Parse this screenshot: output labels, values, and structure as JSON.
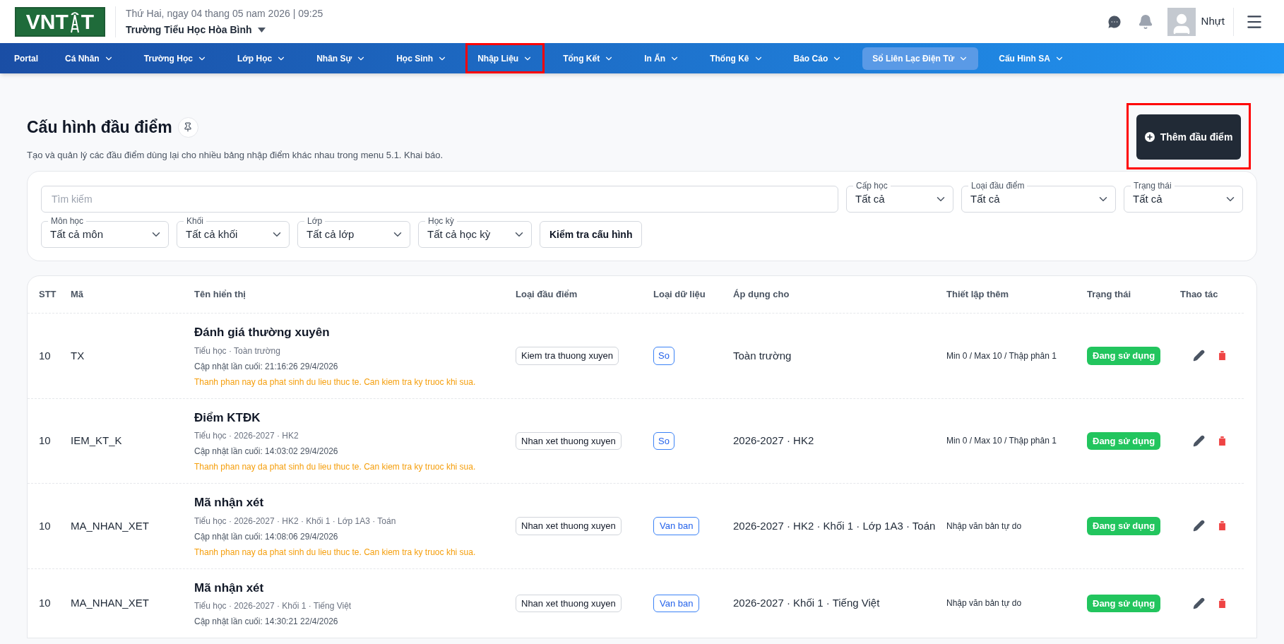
{
  "logo": {
    "text_before": "VNT",
    "text_after": "T"
  },
  "header": {
    "date": "Thứ Hai, ngay 04 thang 05 nam 2026 | 09:25",
    "school": "Trường Tiểu Học Hòa Bình",
    "user": "Nhựt"
  },
  "nav": [
    {
      "label": "Portal",
      "dropdown": false,
      "selected": false,
      "highlighted": false
    },
    {
      "label": "Cá Nhân",
      "dropdown": true,
      "selected": false,
      "highlighted": false
    },
    {
      "label": "Trường Học",
      "dropdown": true,
      "selected": false,
      "highlighted": false
    },
    {
      "label": "Lớp Học",
      "dropdown": true,
      "selected": false,
      "highlighted": false
    },
    {
      "label": "Nhân Sự",
      "dropdown": true,
      "selected": false,
      "highlighted": false
    },
    {
      "label": "Học Sinh",
      "dropdown": true,
      "selected": false,
      "highlighted": false
    },
    {
      "label": "Nhập Liệu",
      "dropdown": true,
      "selected": false,
      "highlighted": true
    },
    {
      "label": "Tổng Kết",
      "dropdown": true,
      "selected": false,
      "highlighted": false
    },
    {
      "label": "In Ấn",
      "dropdown": true,
      "selected": false,
      "highlighted": false
    },
    {
      "label": "Thống Kê",
      "dropdown": true,
      "selected": false,
      "highlighted": false
    },
    {
      "label": "Báo Cáo",
      "dropdown": true,
      "selected": false,
      "highlighted": false
    },
    {
      "label": "Sổ Liên Lạc Điện Tử",
      "dropdown": true,
      "selected": true,
      "highlighted": false
    },
    {
      "label": "Cấu Hình SA",
      "dropdown": true,
      "selected": false,
      "highlighted": false
    }
  ],
  "page": {
    "title": "Cấu hình đầu điểm",
    "description": "Tạo và quản lý các đầu điểm dùng lại cho nhiều bảng nhập điểm khác nhau trong menu 5.1. Khai báo.",
    "add_button": {
      "label": "Thêm đầu điểm",
      "highlighted": true
    }
  },
  "filters": {
    "search": {
      "placeholder": "Tìm kiếm"
    },
    "row_1_selects": [
      {
        "label": "Cấp học",
        "value": "Tất cả"
      },
      {
        "label": "Loại đầu điểm",
        "value": "Tất cả"
      },
      {
        "label": "Trạng thái",
        "value": "Tất cả"
      }
    ],
    "row_2_selects": [
      {
        "label": "Môn học",
        "value": "Tất cả môn"
      },
      {
        "label": "Khối",
        "value": "Tất cả khối"
      },
      {
        "label": "Lớp",
        "value": "Tất cả lớp"
      },
      {
        "label": "Học kỳ",
        "value": "Tất cả học kỳ"
      }
    ],
    "check_button": "Kiểm tra cấu hình"
  },
  "table": {
    "columns": [
      "STT",
      "Mã",
      "Tên hiển thị",
      "Loại đầu điểm",
      "Loại dữ liệu",
      "Áp dụng cho",
      "Thiết lập thêm",
      "Trạng thái",
      "Thao tác"
    ],
    "rows": [
      {
        "stt": "10",
        "code": "TX",
        "name": "Đánh giá thường xuyên",
        "scope": "Tiểu học · Toàn trường",
        "updated": "Cập nhật lần cuối: 21:16:26 29/4/2026",
        "warning": "Thanh phan nay da phat sinh du lieu thuc te. Can kiem tra ky truoc khi sua.",
        "score_type": "Kiem tra thuong xuyen",
        "data_type": "So",
        "applies_to": "Toàn trường",
        "settings": "Min 0 / Max 10 / Thập phân 1",
        "status": "Đang sử dụng"
      },
      {
        "stt": "10",
        "code": "IEM_KT_K",
        "name": "Điểm KTĐK",
        "scope": "Tiểu học · 2026-2027 · HK2",
        "updated": "Cập nhật lần cuối: 14:03:02 29/4/2026",
        "warning": "Thanh phan nay da phat sinh du lieu thuc te. Can kiem tra ky truoc khi sua.",
        "score_type": "Nhan xet thuong xuyen",
        "data_type": "So",
        "applies_to": "2026-2027 · HK2",
        "settings": "Min 0 / Max 10 / Thập phân 1",
        "status": "Đang sử dụng"
      },
      {
        "stt": "10",
        "code": "MA_NHAN_XET",
        "name": "Mã nhận xét",
        "scope": "Tiểu học · 2026-2027 · HK2 · Khối 1 · Lớp 1A3 · Toán",
        "updated": "Cập nhật lần cuối: 14:08:06 29/4/2026",
        "warning": "Thanh phan nay da phat sinh du lieu thuc te. Can kiem tra ky truoc khi sua.",
        "score_type": "Nhan xet thuong xuyen",
        "data_type": "Van ban",
        "applies_to": "2026-2027 · HK2 · Khối 1 · Lớp 1A3 · Toán",
        "settings": "Nhập văn bản tự do",
        "status": "Đang sử dụng"
      },
      {
        "stt": "10",
        "code": "MA_NHAN_XET",
        "name": "Mã nhận xét",
        "scope": "Tiểu học · 2026-2027 · Khối 1 · Tiếng Việt",
        "updated": "Cập nhật lần cuối: 14:30:21 22/4/2026",
        "score_type": "Nhan xet thuong xuyen",
        "data_type": "Van ban",
        "applies_to": "2026-2027 · Khối 1 · Tiếng Việt",
        "settings": "Nhập văn bản tự do",
        "status": "Đang sử dụng"
      }
    ]
  }
}
